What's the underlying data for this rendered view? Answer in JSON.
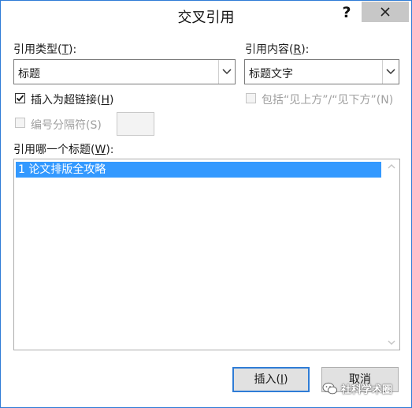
{
  "dialog": {
    "title": "交叉引用",
    "help_symbol": "?"
  },
  "reference_type": {
    "label": "引用类型",
    "hotkey": "T",
    "selected": "标题"
  },
  "reference_content": {
    "label": "引用内容",
    "hotkey": "R",
    "selected": "标题文字"
  },
  "insert_hyperlink": {
    "label": "插入为超链接",
    "hotkey": "H",
    "checked": true
  },
  "include_above_below": {
    "label": "包括“见上方”/“见下方”",
    "hotkey": "N",
    "enabled": false
  },
  "number_separator": {
    "label": "编号分隔符(S)",
    "enabled": false
  },
  "which_heading": {
    "label": "引用哪一个标题",
    "hotkey": "W",
    "items": [
      "1 论文排版全攻略"
    ],
    "selected_index": 0
  },
  "buttons": {
    "insert": "插入",
    "insert_hotkey": "I",
    "cancel": "取消"
  },
  "watermark": "社科学术圈",
  "colors": {
    "accent": "#2f7cd6",
    "selection": "#3399ff",
    "close_button_bg": "#c7c7c7"
  }
}
